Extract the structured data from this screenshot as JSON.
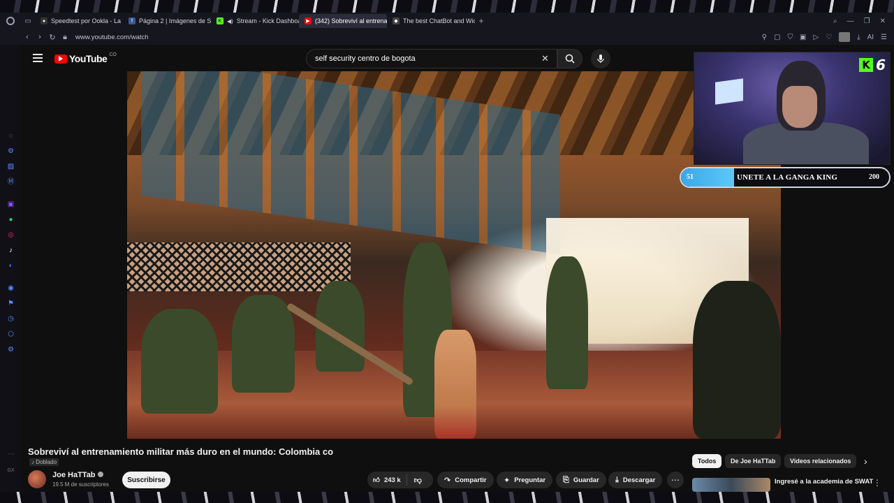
{
  "browser": {
    "tabs": [
      {
        "label": "Speedtest por Ookla - La p",
        "icon": "github-icon",
        "active": false
      },
      {
        "label": "Página 2 | Imágenes de St",
        "icon": "facebook-icon",
        "active": false
      },
      {
        "label": "Stream - Kick Dashboar",
        "icon": "kick-icon",
        "active": false
      },
      {
        "label": "(342) Sobreviví al entrena",
        "icon": "youtube-icon",
        "active": true
      },
      {
        "label": "The best ChatBot and Wid",
        "icon": "chatbot-icon",
        "active": false
      }
    ],
    "url": "www.youtube.com/watch",
    "ai_label": "AI"
  },
  "youtube": {
    "logo_text": "YouTube",
    "country_code": "CO",
    "search_query": "self security centro de bogota"
  },
  "overlay": {
    "kick_letter": "K",
    "kick_count": "6",
    "goal_current": "51",
    "goal_label": "UNETE A LA GANGA KING",
    "goal_target": "200",
    "goal_progress": 0.255
  },
  "video": {
    "title": "Sobreviví al entrenamiento militar más duro en el mundo: Colombia co",
    "dub_label": "Doblado",
    "channel_name": "Joe HaTTab",
    "subscribers": "19.5 M de suscriptores",
    "subscribe_label": "Suscribirse",
    "likes": "243 k",
    "actions": {
      "share": "Compartir",
      "ask": "Preguntar",
      "save": "Guardar",
      "download": "Descargar"
    }
  },
  "related": {
    "chips": [
      "Todos",
      "De Joe HaTTab",
      "Videos relacionados"
    ],
    "first_title": "Ingresé a la academia de SWAT"
  }
}
